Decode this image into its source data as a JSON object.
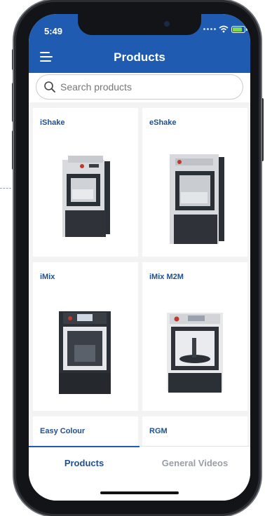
{
  "status_bar": {
    "time": "5:49"
  },
  "header": {
    "title": "Products"
  },
  "search": {
    "placeholder": "Search products",
    "value": ""
  },
  "products": [
    {
      "name": "iShake"
    },
    {
      "name": "eShake"
    },
    {
      "name": "iMix"
    },
    {
      "name": "iMix M2M"
    },
    {
      "name": "Easy Colour"
    },
    {
      "name": "RGM"
    }
  ],
  "tabs": [
    {
      "label": "Products",
      "active": true
    },
    {
      "label": "General Videos",
      "active": false
    }
  ],
  "colors": {
    "brand": "#1f5bb0",
    "title_text": "#1f4f8f",
    "inactive_tab": "#9a9ea5"
  }
}
